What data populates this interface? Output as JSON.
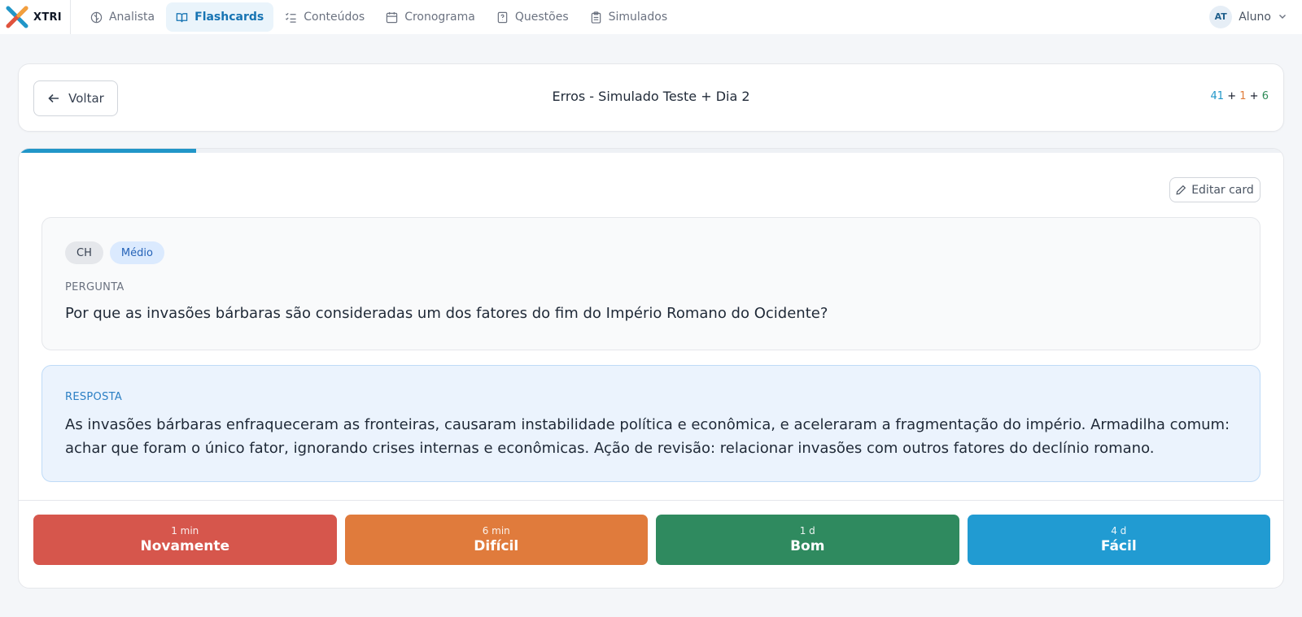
{
  "navbar": {
    "brand": "XTRI",
    "items": [
      {
        "label": "Analista",
        "active": false
      },
      {
        "label": "Flashcards",
        "active": true
      },
      {
        "label": "Conteúdos",
        "active": false
      },
      {
        "label": "Cronograma",
        "active": false
      },
      {
        "label": "Questões",
        "active": false
      },
      {
        "label": "Simulados",
        "active": false
      }
    ],
    "user": {
      "initials": "AT",
      "name": "Aluno"
    }
  },
  "header": {
    "back_label": "Voltar",
    "title": "Erros - Simulado Teste + Dia 2",
    "counts": {
      "new": "41",
      "learning": "1",
      "review": "6",
      "plus": "+"
    }
  },
  "card": {
    "progress_fraction": 0.14,
    "edit_label": "Editar card",
    "tags": {
      "subject": "CH",
      "level": "Médio"
    },
    "question_label": "PERGUNTA",
    "question": "Por que as invasões bárbaras são consideradas um dos fatores do fim do Império Romano do Ocidente?",
    "answer_label": "RESPOSTA",
    "answer": "As invasões bárbaras enfraqueceram as fronteiras, causaram instabilidade política e econômica, e aceleraram a fragmentação do império. Armadilha comum: achar que foram o único fator, ignorando crises internas e econômicas. Ação de revisão: relacionar invasões com outros fatores do declínio romano."
  },
  "ratings": [
    {
      "time": "1 min",
      "label": "Novamente",
      "color": "#d6564c"
    },
    {
      "time": "6 min",
      "label": "Difícil",
      "color": "#e07b3c"
    },
    {
      "time": "1 d",
      "label": "Bom",
      "color": "#2f8a5f"
    },
    {
      "time": "4 d",
      "label": "Fácil",
      "color": "#219bd2"
    }
  ],
  "colors": {
    "accent": "#2196c8",
    "nav_active": "#1774b3"
  }
}
